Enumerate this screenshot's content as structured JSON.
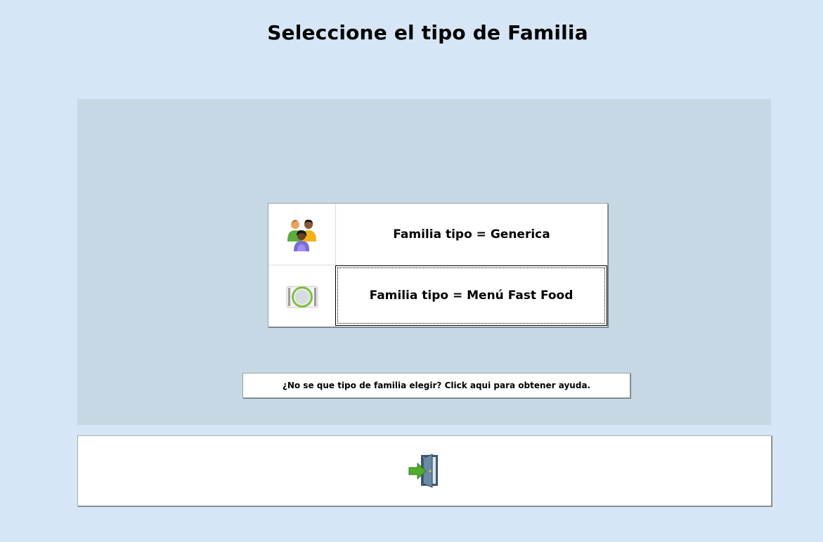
{
  "page": {
    "title": "Seleccione el tipo de Familia"
  },
  "options": [
    {
      "label": "Familia tipo = Generica",
      "icon": "people-group-icon"
    },
    {
      "label": "Familia tipo = Menú Fast Food",
      "icon": "plate-icon"
    }
  ],
  "help": {
    "label": "¿No se que tipo de familia elegir? Click aqui para obtener ayuda."
  },
  "footer": {
    "exit_icon": "exit-door-icon"
  },
  "colors": {
    "background": "#d7e6f6",
    "panel": "#c5d8e3",
    "button_face": "#ffffff"
  }
}
